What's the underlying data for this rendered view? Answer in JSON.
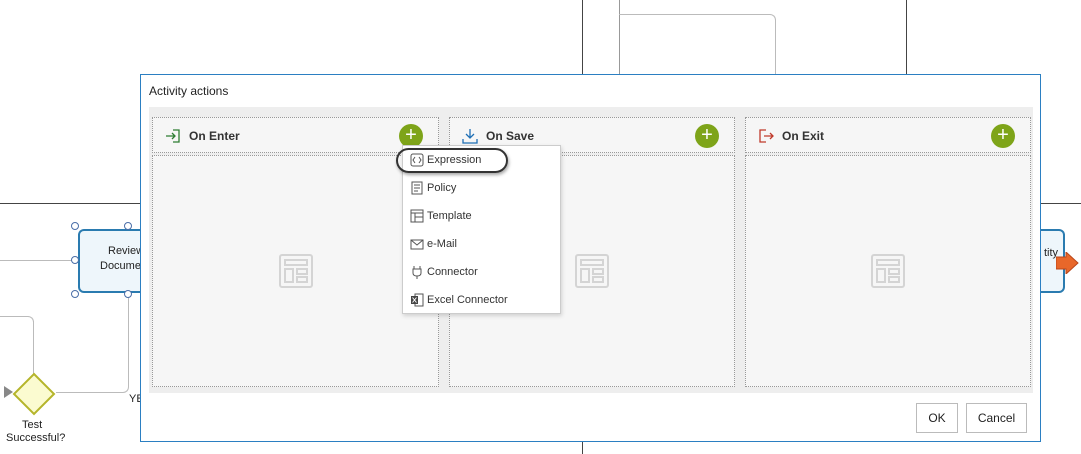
{
  "diagram": {
    "node_left_label_1": "Review",
    "node_left_label_2": "Docume",
    "node_right_label": "tity",
    "gateway_label_1": "Test",
    "gateway_label_2": "Successful?",
    "yes_label": "YE"
  },
  "dialog": {
    "title": "Activity actions",
    "panels": [
      {
        "title": "On Enter",
        "icon": "enter-icon"
      },
      {
        "title": "On Save",
        "icon": "save-icon"
      },
      {
        "title": "On Exit",
        "icon": "exit-icon"
      }
    ],
    "add_symbol": "+",
    "ok_label": "OK",
    "cancel_label": "Cancel"
  },
  "menu": {
    "items": [
      {
        "label": "Expression",
        "icon": "expression-icon"
      },
      {
        "label": "Policy",
        "icon": "policy-icon"
      },
      {
        "label": "Template",
        "icon": "template-icon"
      },
      {
        "label": "e-Mail",
        "icon": "email-icon"
      },
      {
        "label": "Connector",
        "icon": "connector-icon"
      },
      {
        "label": "Excel Connector",
        "icon": "excel-icon"
      }
    ]
  },
  "colors": {
    "accent_blue": "#2b7fc2",
    "add_green": "#7ea419",
    "enter_green": "#2e7d32",
    "save_blue": "#1e6fb5",
    "exit_red": "#c0392b"
  }
}
